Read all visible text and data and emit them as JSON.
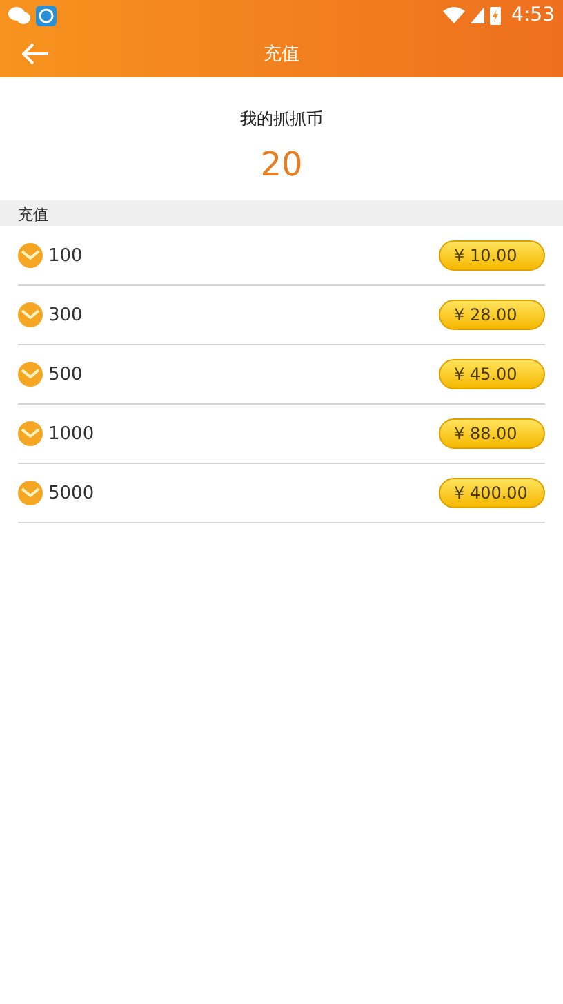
{
  "status_bar": {
    "time": "4:53"
  },
  "header": {
    "title": "充值"
  },
  "balance": {
    "label": "我的抓抓币",
    "value": "20"
  },
  "section": {
    "title": "充值"
  },
  "packages": [
    {
      "amount": "100",
      "price": "¥ 10.00"
    },
    {
      "amount": "300",
      "price": "¥ 28.00"
    },
    {
      "amount": "500",
      "price": "¥ 45.00"
    },
    {
      "amount": "1000",
      "price": "¥ 88.00"
    },
    {
      "amount": "5000",
      "price": "¥ 400.00"
    }
  ]
}
